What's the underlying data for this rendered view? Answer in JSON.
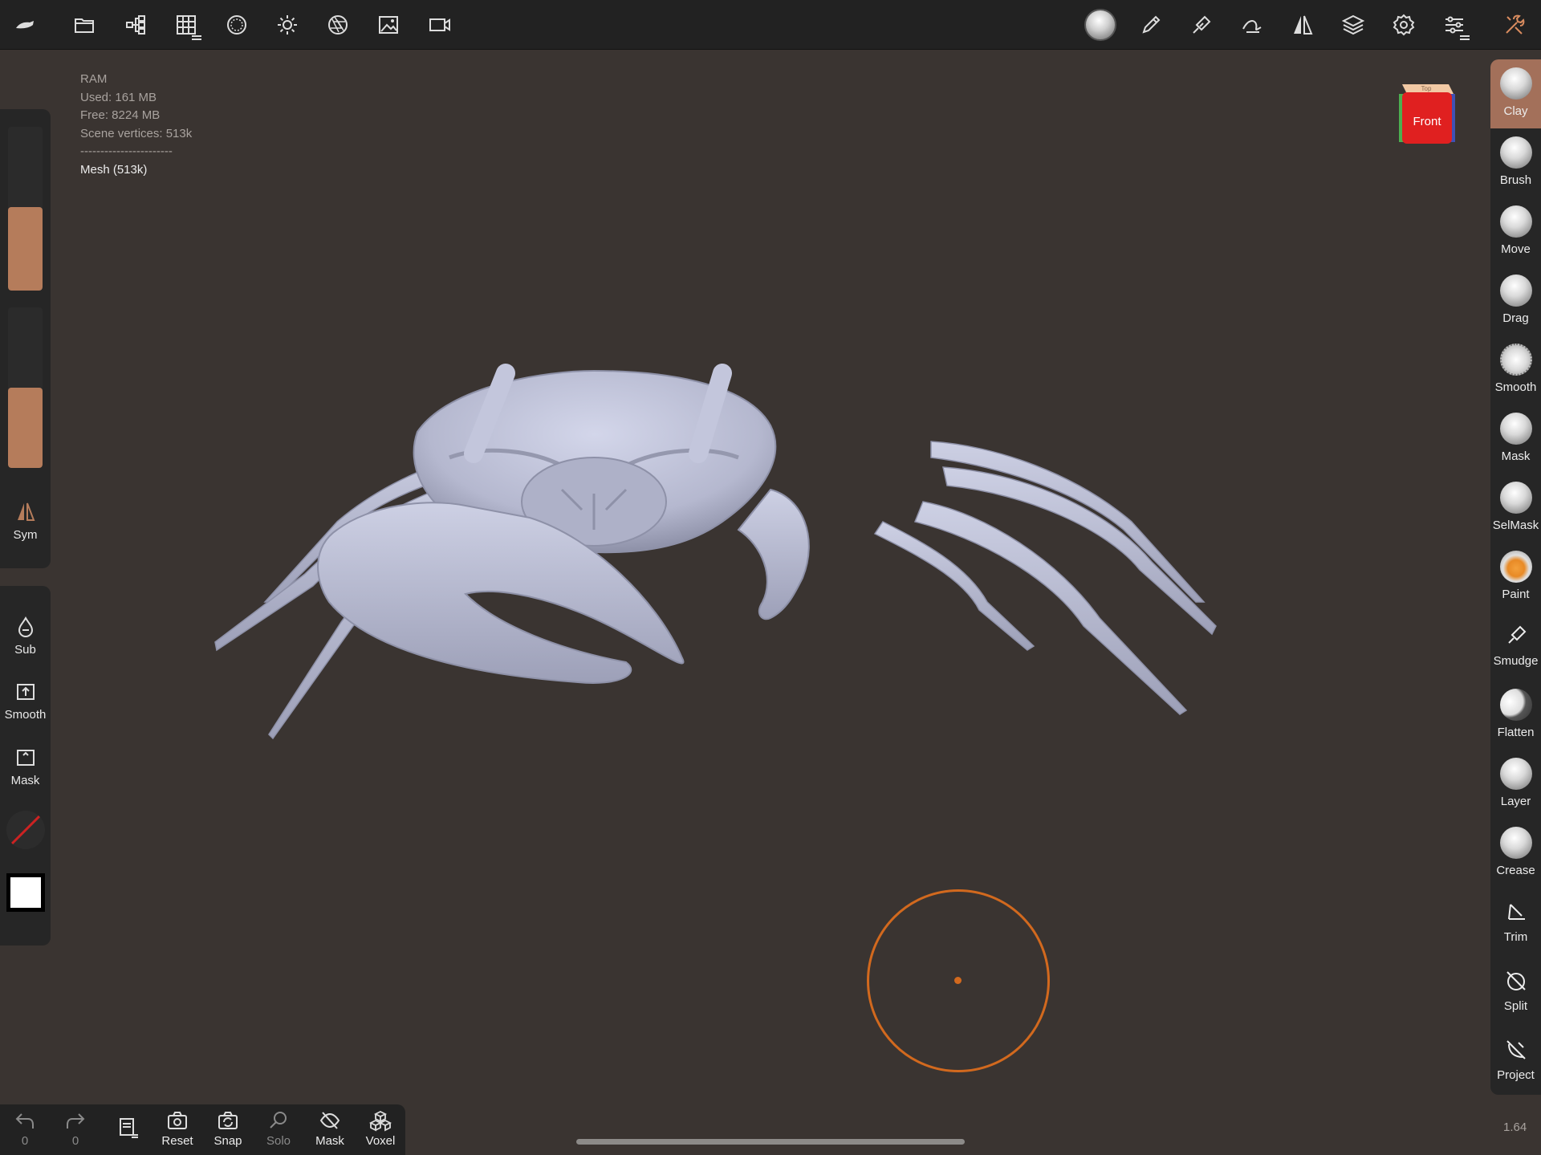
{
  "stats": {
    "ram": "RAM",
    "used": "Used: 161 MB",
    "free": "Free: 8224 MB",
    "vertices": "Scene vertices: 513k",
    "divider": "-----------------------",
    "mesh": "Mesh (513k)"
  },
  "topbar": {
    "icons": [
      "logo-icon",
      "folder-icon",
      "scene-tree-icon",
      "grid-icon",
      "material-icon",
      "light-icon",
      "aperture-icon",
      "image-icon",
      "camera-icon",
      "matcap-sphere-icon",
      "pen-icon",
      "brush-icon",
      "stroke-icon",
      "mirror-icon",
      "layers-icon",
      "settings-icon",
      "sliders-icon",
      "tools-icon"
    ]
  },
  "left": {
    "slider_top_level": 0.51,
    "slider_bottom_level": 0.5,
    "sym_label": "Sym",
    "sub_label": "Sub",
    "smooth_label": "Smooth",
    "mask_label": "Mask"
  },
  "tools": [
    {
      "label": "Clay",
      "active": true
    },
    {
      "label": "Brush"
    },
    {
      "label": "Move"
    },
    {
      "label": "Drag"
    },
    {
      "label": "Smooth"
    },
    {
      "label": "Mask"
    },
    {
      "label": "SelMask"
    },
    {
      "label": "Paint"
    },
    {
      "label": "Smudge"
    },
    {
      "label": "Flatten"
    },
    {
      "label": "Layer"
    },
    {
      "label": "Crease"
    },
    {
      "label": "Trim"
    },
    {
      "label": "Split"
    },
    {
      "label": "Project"
    }
  ],
  "viewcube": {
    "top": "Top",
    "front": "Front"
  },
  "bottom": {
    "undo_count": "0",
    "redo_count": "0",
    "reset": "Reset",
    "snap": "Snap",
    "solo": "Solo",
    "mask": "Mask",
    "voxel": "Voxel"
  },
  "zoom": "1.64",
  "colors": {
    "accent": "#b57c5b",
    "brush_cursor": "#d2691e",
    "background": "#3a3431",
    "mesh": "#c3c6dc"
  }
}
